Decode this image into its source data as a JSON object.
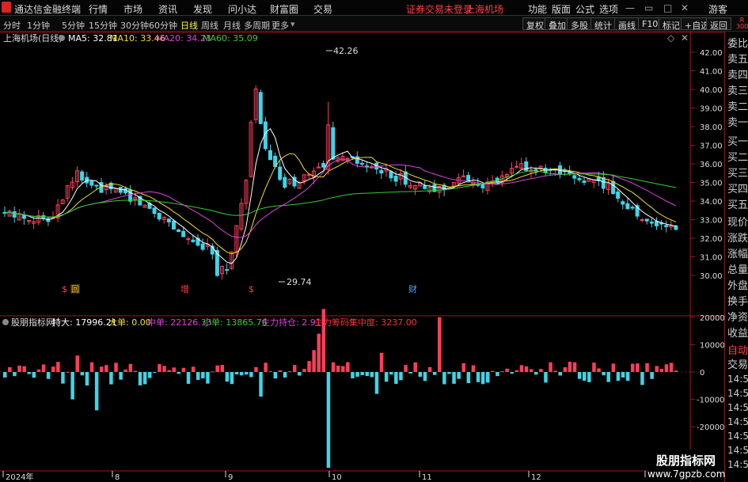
{
  "menubar": {
    "app_title": "通达信金融终端",
    "items": [
      "行情",
      "市场",
      "资讯",
      "发现",
      "问小达",
      "财富圈",
      "交易"
    ],
    "notice": "证券交易未登录",
    "stock": "上海机场",
    "right_items": [
      "功能",
      "版面",
      "公式",
      "选项"
    ],
    "guest": "游客"
  },
  "tabbar": {
    "periods": [
      "分时",
      "1分钟",
      "5分钟",
      "15分钟",
      "30分钟",
      "60分钟",
      "日线",
      "周线",
      "月线",
      "多周期",
      "更多"
    ],
    "active": "日线",
    "buttons": [
      "复权",
      "叠加",
      "多股",
      "统计",
      "画线",
      "F10",
      "标记",
      "+自选",
      "返回"
    ]
  },
  "main_chart": {
    "label": "上海机场(日线)",
    "ma5": "MA5: 32.81",
    "ma10": "MA10: 33.46",
    "ma20": "MA20: 34.23",
    "ma60": "MA60: 35.09",
    "high_label": "42.26",
    "low_label": "29.74",
    "y_ticks": [
      "42.00",
      "41.00",
      "40.00",
      "39.00",
      "38.00",
      "37.00",
      "36.00",
      "35.00",
      "34.00",
      "33.00",
      "32.00",
      "31.00",
      "30.00"
    ],
    "markers": [
      "$",
      "回",
      "增",
      "$",
      "财"
    ]
  },
  "sub_chart": {
    "name": "股朋指标网",
    "te_da": "特大: 17996.21",
    "da_dan": "大单: 0.00",
    "zhong_dan": "中单: 22126.33",
    "xiao_dan": "小单: 13865.76",
    "zhuli": "主力持仓: 2.91",
    "chouma": "主力筹码集中度: 3237.00",
    "y_ticks": [
      "20000",
      "10000",
      "0",
      "-10000",
      "-20000"
    ]
  },
  "x_axis": [
    "2024年",
    "8",
    "9",
    "10",
    "11",
    "12",
    "1"
  ],
  "right_panel": {
    "top": [
      "委比",
      "卖五",
      "卖四",
      "卖三",
      "卖二",
      "卖一",
      "买一",
      "买二",
      "买三",
      "买四",
      "买五",
      "现价",
      "涨跌",
      "涨幅",
      "总量",
      "外盘",
      "换手",
      "净资",
      "收益"
    ],
    "badge": "R",
    "badge_num": "300",
    "bottom": [
      "自动",
      "交易"
    ],
    "times": [
      "14:56",
      "14:56",
      "14:56",
      "14:56",
      "14:56",
      "14:56",
      "14:56",
      "14:56",
      "14:56",
      "14:56"
    ]
  },
  "watermark": {
    "line1": "股朋指标网",
    "line2": "www.7gpzb.com"
  },
  "colors": {
    "up": "#ff3d5a",
    "down": "#3fd4e8",
    "ma5": "#ffffff",
    "ma10": "#f0e020",
    "ma20": "#e040e0",
    "ma60": "#30d030",
    "axis_red": "#a01818"
  }
}
